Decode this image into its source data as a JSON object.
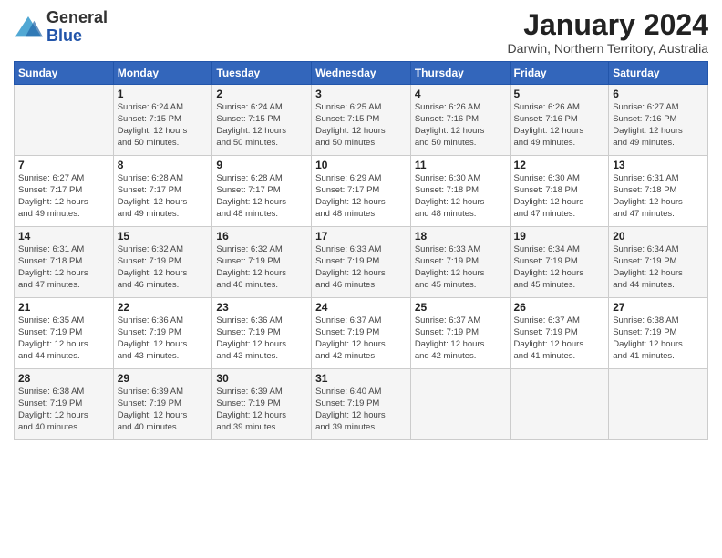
{
  "header": {
    "logo_general": "General",
    "logo_blue": "Blue",
    "month_title": "January 2024",
    "subtitle": "Darwin, Northern Territory, Australia"
  },
  "days_of_week": [
    "Sunday",
    "Monday",
    "Tuesday",
    "Wednesday",
    "Thursday",
    "Friday",
    "Saturday"
  ],
  "weeks": [
    [
      {
        "day": "",
        "info": ""
      },
      {
        "day": "1",
        "info": "Sunrise: 6:24 AM\nSunset: 7:15 PM\nDaylight: 12 hours\nand 50 minutes."
      },
      {
        "day": "2",
        "info": "Sunrise: 6:24 AM\nSunset: 7:15 PM\nDaylight: 12 hours\nand 50 minutes."
      },
      {
        "day": "3",
        "info": "Sunrise: 6:25 AM\nSunset: 7:15 PM\nDaylight: 12 hours\nand 50 minutes."
      },
      {
        "day": "4",
        "info": "Sunrise: 6:26 AM\nSunset: 7:16 PM\nDaylight: 12 hours\nand 50 minutes."
      },
      {
        "day": "5",
        "info": "Sunrise: 6:26 AM\nSunset: 7:16 PM\nDaylight: 12 hours\nand 49 minutes."
      },
      {
        "day": "6",
        "info": "Sunrise: 6:27 AM\nSunset: 7:16 PM\nDaylight: 12 hours\nand 49 minutes."
      }
    ],
    [
      {
        "day": "7",
        "info": "Sunrise: 6:27 AM\nSunset: 7:17 PM\nDaylight: 12 hours\nand 49 minutes."
      },
      {
        "day": "8",
        "info": "Sunrise: 6:28 AM\nSunset: 7:17 PM\nDaylight: 12 hours\nand 49 minutes."
      },
      {
        "day": "9",
        "info": "Sunrise: 6:28 AM\nSunset: 7:17 PM\nDaylight: 12 hours\nand 48 minutes."
      },
      {
        "day": "10",
        "info": "Sunrise: 6:29 AM\nSunset: 7:17 PM\nDaylight: 12 hours\nand 48 minutes."
      },
      {
        "day": "11",
        "info": "Sunrise: 6:30 AM\nSunset: 7:18 PM\nDaylight: 12 hours\nand 48 minutes."
      },
      {
        "day": "12",
        "info": "Sunrise: 6:30 AM\nSunset: 7:18 PM\nDaylight: 12 hours\nand 47 minutes."
      },
      {
        "day": "13",
        "info": "Sunrise: 6:31 AM\nSunset: 7:18 PM\nDaylight: 12 hours\nand 47 minutes."
      }
    ],
    [
      {
        "day": "14",
        "info": "Sunrise: 6:31 AM\nSunset: 7:18 PM\nDaylight: 12 hours\nand 47 minutes."
      },
      {
        "day": "15",
        "info": "Sunrise: 6:32 AM\nSunset: 7:19 PM\nDaylight: 12 hours\nand 46 minutes."
      },
      {
        "day": "16",
        "info": "Sunrise: 6:32 AM\nSunset: 7:19 PM\nDaylight: 12 hours\nand 46 minutes."
      },
      {
        "day": "17",
        "info": "Sunrise: 6:33 AM\nSunset: 7:19 PM\nDaylight: 12 hours\nand 46 minutes."
      },
      {
        "day": "18",
        "info": "Sunrise: 6:33 AM\nSunset: 7:19 PM\nDaylight: 12 hours\nand 45 minutes."
      },
      {
        "day": "19",
        "info": "Sunrise: 6:34 AM\nSunset: 7:19 PM\nDaylight: 12 hours\nand 45 minutes."
      },
      {
        "day": "20",
        "info": "Sunrise: 6:34 AM\nSunset: 7:19 PM\nDaylight: 12 hours\nand 44 minutes."
      }
    ],
    [
      {
        "day": "21",
        "info": "Sunrise: 6:35 AM\nSunset: 7:19 PM\nDaylight: 12 hours\nand 44 minutes."
      },
      {
        "day": "22",
        "info": "Sunrise: 6:36 AM\nSunset: 7:19 PM\nDaylight: 12 hours\nand 43 minutes."
      },
      {
        "day": "23",
        "info": "Sunrise: 6:36 AM\nSunset: 7:19 PM\nDaylight: 12 hours\nand 43 minutes."
      },
      {
        "day": "24",
        "info": "Sunrise: 6:37 AM\nSunset: 7:19 PM\nDaylight: 12 hours\nand 42 minutes."
      },
      {
        "day": "25",
        "info": "Sunrise: 6:37 AM\nSunset: 7:19 PM\nDaylight: 12 hours\nand 42 minutes."
      },
      {
        "day": "26",
        "info": "Sunrise: 6:37 AM\nSunset: 7:19 PM\nDaylight: 12 hours\nand 41 minutes."
      },
      {
        "day": "27",
        "info": "Sunrise: 6:38 AM\nSunset: 7:19 PM\nDaylight: 12 hours\nand 41 minutes."
      }
    ],
    [
      {
        "day": "28",
        "info": "Sunrise: 6:38 AM\nSunset: 7:19 PM\nDaylight: 12 hours\nand 40 minutes."
      },
      {
        "day": "29",
        "info": "Sunrise: 6:39 AM\nSunset: 7:19 PM\nDaylight: 12 hours\nand 40 minutes."
      },
      {
        "day": "30",
        "info": "Sunrise: 6:39 AM\nSunset: 7:19 PM\nDaylight: 12 hours\nand 39 minutes."
      },
      {
        "day": "31",
        "info": "Sunrise: 6:40 AM\nSunset: 7:19 PM\nDaylight: 12 hours\nand 39 minutes."
      },
      {
        "day": "",
        "info": ""
      },
      {
        "day": "",
        "info": ""
      },
      {
        "day": "",
        "info": ""
      }
    ]
  ]
}
